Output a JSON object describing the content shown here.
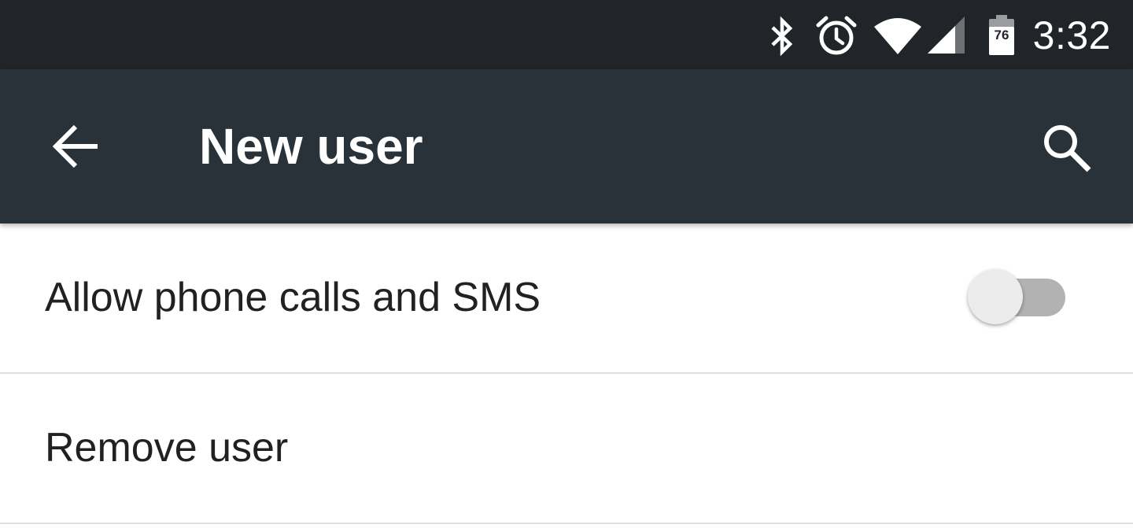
{
  "status_bar": {
    "time": "3:32",
    "battery_level": "76",
    "icons": [
      "bluetooth-icon",
      "alarm-icon",
      "wifi-icon",
      "cell-signal-icon",
      "battery-icon"
    ]
  },
  "toolbar": {
    "title": "New user",
    "back_icon": "arrow-left-icon",
    "search_icon": "search-icon"
  },
  "settings": {
    "items": [
      {
        "label": "Allow phone calls and SMS",
        "toggle": false
      },
      {
        "label": "Remove user"
      }
    ]
  },
  "colors": {
    "status_bar_bg": "#212529",
    "toolbar_bg": "#283238",
    "text": "#212121",
    "divider": "#e0e0e0",
    "switch_track_off": "#b2b2b2",
    "switch_thumb_off": "#ececec"
  }
}
